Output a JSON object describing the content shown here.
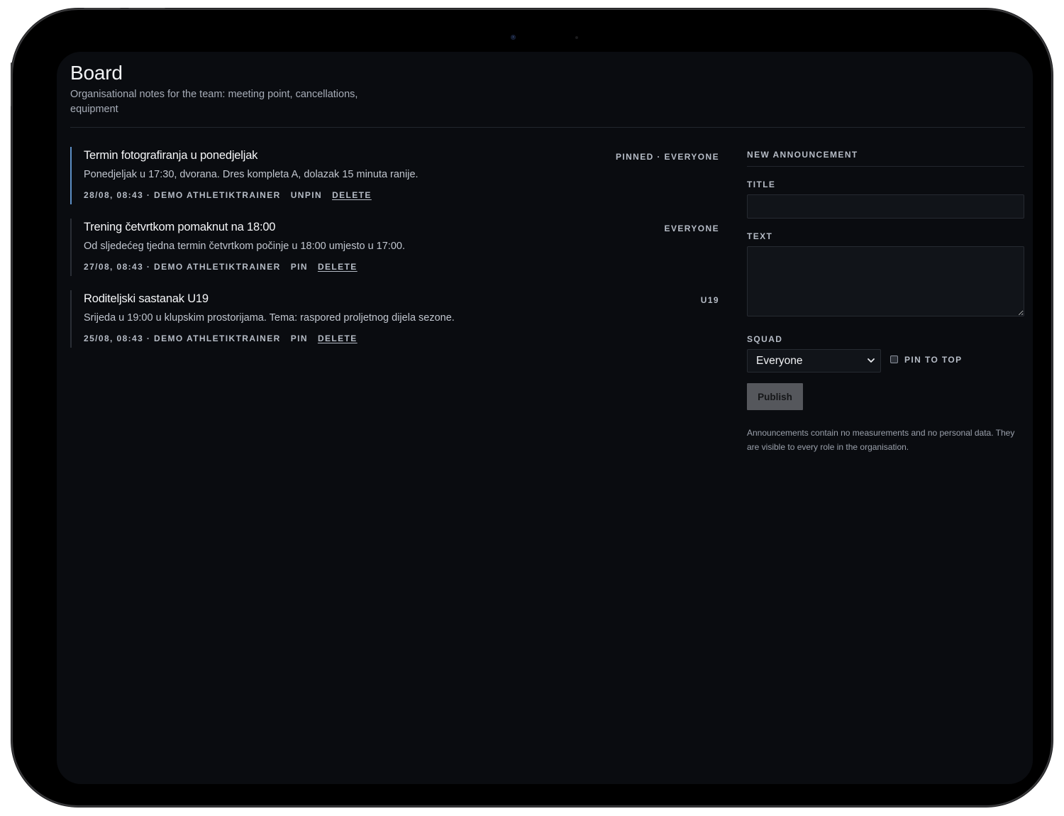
{
  "header": {
    "title": "Board",
    "subtitle": "Organisational notes for the team: meeting point, cancellations, equipment"
  },
  "announcements": [
    {
      "title": "Termin fotografiranja u ponedjeljak",
      "tag": "PINNED · EVERYONE",
      "body": "Ponedjeljak u 17:30, dvorana. Dres kompleta A, dolazak 15 minuta ranije.",
      "meta": "28/08, 08:43 · DEMO ATHLETIKTRAINER",
      "pin_action": "UNPIN",
      "delete_action": "DELETE",
      "pinned": true
    },
    {
      "title": "Trening četvrtkom pomaknut na 18:00",
      "tag": "EVERYONE",
      "body": "Od sljedećeg tjedna termin četvrtkom počinje u 18:00 umjesto u 17:00.",
      "meta": "27/08, 08:43 · DEMO ATHLETIKTRAINER",
      "pin_action": "PIN",
      "delete_action": "DELETE",
      "pinned": false
    },
    {
      "title": "Roditeljski sastanak U19",
      "tag": "U19",
      "body": "Srijeda u 19:00 u klupskim prostorijama. Tema: raspored proljetnog dijela sezone.",
      "meta": "25/08, 08:43 · DEMO ATHLETIKTRAINER",
      "pin_action": "PIN",
      "delete_action": "DELETE",
      "pinned": false
    }
  ],
  "form": {
    "heading": "NEW ANNOUNCEMENT",
    "title_label": "TITLE",
    "title_value": "",
    "text_label": "TEXT",
    "text_value": "",
    "squad_label": "SQUAD",
    "squad_selected": "Everyone",
    "pin_label": "PIN TO TOP",
    "pin_checked": false,
    "publish_label": "Publish",
    "note": "Announcements contain no measurements and no personal data. They are visible to every role in the organisation."
  },
  "colors": {
    "screen_bg": "#0a0c10",
    "pinned_accent": "#5d8fc6",
    "muted_text": "#b6bcc6",
    "button_bg": "#55575c"
  }
}
